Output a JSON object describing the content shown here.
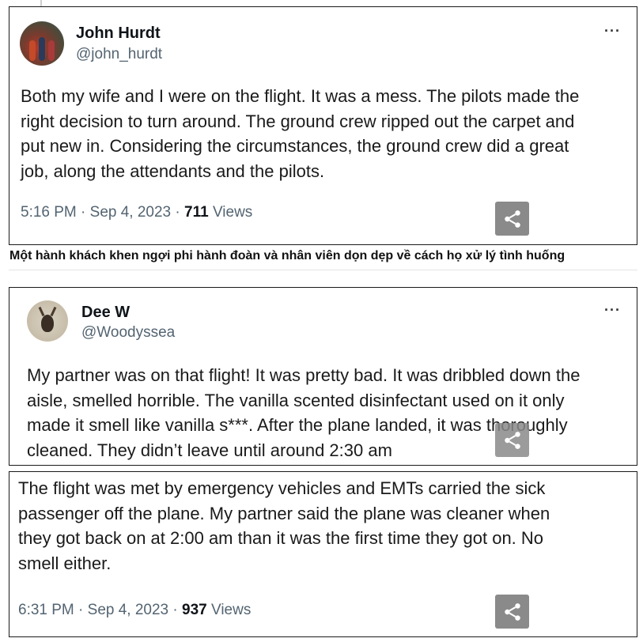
{
  "tweet1": {
    "name": "John Hurdt",
    "handle": "@john_hurdt",
    "more": "···",
    "lines": [
      "Both my wife and I were on the flight. It was a mess. The pilots made the",
      "right decision to turn around. The ground crew ripped out the carpet and",
      "put new in. Considering the circumstances, the ground crew did a great",
      "job, along the attendants and the pilots."
    ],
    "time": "5:16 PM · Sep 4, 2023 · ",
    "views_count": "711",
    "views_label": " Views"
  },
  "caption": "Một hành khách khen ngợi phi hành đoàn và nhân viên dọn dẹp về cách họ xử lý tình huống",
  "tweet2": {
    "name": "Dee W",
    "handle": "@Woodyssea",
    "more": "···",
    "lines_a": [
      "My partner was on that flight! It was pretty bad. It was dribbled down the",
      "aisle, smelled horrible. The vanilla scented disinfectant used on it only",
      "made it smell like vanilla s***. After the plane landed, it was thoroughly",
      "cleaned. They didn’t leave until around 2:30 am"
    ],
    "lines_b": [
      "The flight was met by emergency vehicles and EMTs carried the sick",
      "passenger off the plane. My partner said the plane was cleaner when",
      "they got back on at 2:00 am than it was the first time they got on. No",
      "smell either."
    ],
    "time": "6:31 PM · Sep 4, 2023 · ",
    "views_count": "937",
    "views_label": " Views"
  },
  "icons": {
    "share": "share-icon",
    "more": "more-options-icon"
  },
  "colors": {
    "share_button": "#8a8a8a",
    "secondary_text": "#536471"
  }
}
